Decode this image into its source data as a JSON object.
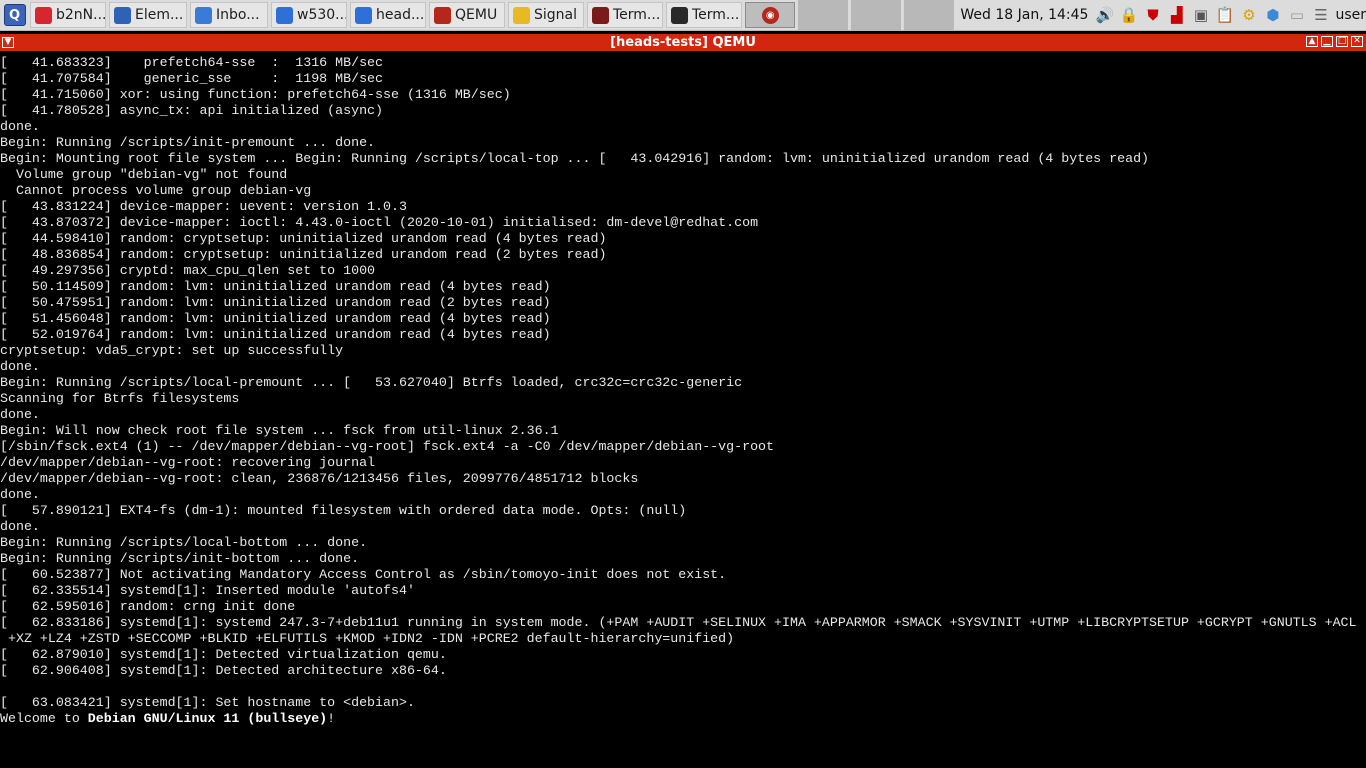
{
  "taskbar": {
    "tasks": [
      {
        "label": "b2nN...",
        "icon": "document-icon",
        "color": "#d9262e"
      },
      {
        "label": "Elem...",
        "icon": "element-icon",
        "color": "#2f62b6"
      },
      {
        "label": "Inbo...",
        "icon": "mail-icon",
        "color": "#3a7bd5"
      },
      {
        "label": "w530...",
        "icon": "firefox-icon",
        "color": "#2e6fd8"
      },
      {
        "label": "head...",
        "icon": "firefox-icon",
        "color": "#2e6fd8"
      },
      {
        "label": "QEMU",
        "icon": "qemu-icon",
        "color": "#b5261b"
      },
      {
        "label": "Signal",
        "icon": "signal-icon",
        "color": "#e8b923"
      },
      {
        "label": "Term...",
        "icon": "terminal-icon",
        "color": "#7a1a1a"
      },
      {
        "label": "Term...",
        "icon": "terminal-icon",
        "color": "#2a2a2a"
      }
    ],
    "clock": "Wed 18 Jan, 14:45",
    "user": "user"
  },
  "window": {
    "title": "[heads-tests] QEMU"
  },
  "console_lines": [
    "[   41.683323]    prefetch64-sse  :  1316 MB/sec",
    "[   41.707584]    generic_sse     :  1198 MB/sec",
    "[   41.715060] xor: using function: prefetch64-sse (1316 MB/sec)",
    "[   41.780528] async_tx: api initialized (async)",
    "done.",
    "Begin: Running /scripts/init-premount ... done.",
    "Begin: Mounting root file system ... Begin: Running /scripts/local-top ... [   43.042916] random: lvm: uninitialized urandom read (4 bytes read)",
    "  Volume group \"debian-vg\" not found",
    "  Cannot process volume group debian-vg",
    "[   43.831224] device-mapper: uevent: version 1.0.3",
    "[   43.870372] device-mapper: ioctl: 4.43.0-ioctl (2020-10-01) initialised: dm-devel@redhat.com",
    "[   44.598410] random: cryptsetup: uninitialized urandom read (4 bytes read)",
    "[   48.836854] random: cryptsetup: uninitialized urandom read (2 bytes read)",
    "[   49.297356] cryptd: max_cpu_qlen set to 1000",
    "[   50.114509] random: lvm: uninitialized urandom read (4 bytes read)",
    "[   50.475951] random: lvm: uninitialized urandom read (2 bytes read)",
    "[   51.456048] random: lvm: uninitialized urandom read (4 bytes read)",
    "[   52.019764] random: lvm: uninitialized urandom read (4 bytes read)",
    "cryptsetup: vda5_crypt: set up successfully",
    "done.",
    "Begin: Running /scripts/local-premount ... [   53.627040] Btrfs loaded, crc32c=crc32c-generic",
    "Scanning for Btrfs filesystems",
    "done.",
    "Begin: Will now check root file system ... fsck from util-linux 2.36.1",
    "[/sbin/fsck.ext4 (1) -- /dev/mapper/debian--vg-root] fsck.ext4 -a -C0 /dev/mapper/debian--vg-root",
    "/dev/mapper/debian--vg-root: recovering journal",
    "/dev/mapper/debian--vg-root: clean, 236876/1213456 files, 2099776/4851712 blocks",
    "done.",
    "[   57.890121] EXT4-fs (dm-1): mounted filesystem with ordered data mode. Opts: (null)",
    "done.",
    "Begin: Running /scripts/local-bottom ... done.",
    "Begin: Running /scripts/init-bottom ... done.",
    "[   60.523877] Not activating Mandatory Access Control as /sbin/tomoyo-init does not exist.",
    "[   62.335514] systemd[1]: Inserted module 'autofs4'",
    "[   62.595016] random: crng init done",
    "[   62.833186] systemd[1]: systemd 247.3-7+deb11u1 running in system mode. (+PAM +AUDIT +SELINUX +IMA +APPARMOR +SMACK +SYSVINIT +UTMP +LIBCRYPTSETUP +GCRYPT +GNUTLS +ACL",
    " +XZ +LZ4 +ZSTD +SECCOMP +BLKID +ELFUTILS +KMOD +IDN2 -IDN +PCRE2 default-hierarchy=unified)",
    "[   62.879010] systemd[1]: Detected virtualization qemu.",
    "[   62.906408] systemd[1]: Detected architecture x86-64.",
    "",
    "[   63.083421] systemd[1]: Set hostname to <debian>."
  ],
  "welcome": {
    "prefix": "Welcome to ",
    "os": "Debian GNU/Linux 11 (bullseye)",
    "suffix": "!"
  }
}
